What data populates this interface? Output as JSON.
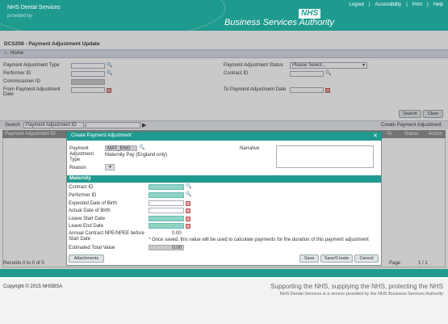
{
  "header": {
    "brand_title": "NHS Dental Services",
    "brand_sub": "provided by",
    "nhs_logo": "NHS",
    "authority": "Business Services Authority",
    "links": [
      "Logout",
      "Accessibility",
      "Print",
      "Help"
    ]
  },
  "page": {
    "title": "DCS208 - Payment Adjustment Update",
    "home": "Home"
  },
  "filters": {
    "payment_adjustment_type": "Payment Adjustment Type",
    "performer_id": "Performer ID",
    "commissioner_id": "Commissioner ID",
    "from_date": "From Payment Adjustment Date",
    "status": "Payment Adjustment Status",
    "status_value": "Please Select...",
    "contract_id": "Contract ID",
    "to_date": "To Payment Adjustment Date",
    "search_button": "Search",
    "clear_button": "Clear"
  },
  "searchbar": {
    "label": "Search",
    "select_value": "Payment Adjustment ID",
    "create_link": "Create Payment Adjustment"
  },
  "grid": {
    "col_id": "Payment Adjustment ID",
    "col_to": "To",
    "col_status": "Status",
    "col_action": "Action",
    "records": "Records 0 to 0 of 0",
    "page_label": "Page",
    "page_value": "1 / 1"
  },
  "modal": {
    "title": "Create Payment Adjustment",
    "type_label": "Payment Adjustment Type",
    "type_code": "MAT_ENG",
    "type_desc": "Maternity Pay (England only)",
    "reason_label": "Reason",
    "narrative_label": "Narrative",
    "section": "Maternity",
    "contract_id": "Contract ID",
    "performer_id": "Performer ID",
    "expected_dob": "Expected Date of Birth",
    "actual_dob": "Actual Date of Birth",
    "leave_start": "Leave Start Date",
    "leave_end": "Leave End Date",
    "annual_contract": "Annual Contract NPE/NPEE before Start Date",
    "annual_value": "0.00",
    "note": "* Once saved, this value will be used to calculate payments for the duration of this payment adjustment",
    "estimated_total": "Estimated Total Value",
    "estimated_value": "0.00",
    "attachments": "Attachments",
    "save": "Save",
    "save_create": "Save/Create",
    "cancel": "Cancel"
  },
  "footer": {
    "copyright": "Copyright © 2015 NHSBSA",
    "tagline": "Supporting the NHS, supplying the NHS, protecting the NHS",
    "provided": "NHS Dental Services is a service provided by the NHS Business Services Authority"
  }
}
